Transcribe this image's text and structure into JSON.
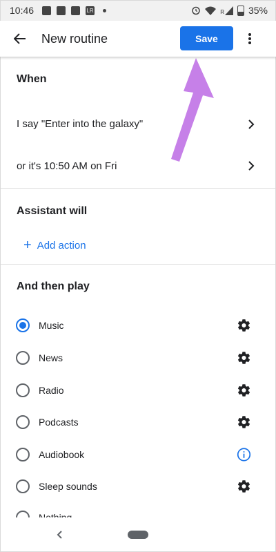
{
  "status_bar": {
    "time": "10:46",
    "battery": "35%",
    "left_icons": [
      "image-icon",
      "news-icon",
      "chat-icon",
      "lightroom-icon"
    ],
    "lightroom_text": "LR",
    "right_icons": [
      "alarm-icon",
      "wifi-icon",
      "signal-icon",
      "battery-icon"
    ],
    "signal_label": "R"
  },
  "app_bar": {
    "title": "New routine",
    "save_label": "Save",
    "accent": "#1a73e8"
  },
  "when_section": {
    "heading": "When",
    "rows": [
      {
        "label": "I say \"Enter into the galaxy\""
      },
      {
        "label": "or it's 10:50 AM on Fri"
      }
    ]
  },
  "assistant_section": {
    "heading": "Assistant will",
    "add_action_label": "Add action"
  },
  "then_play_section": {
    "heading": "And then play",
    "options": [
      {
        "label": "Music",
        "selected": true,
        "icon": "gear-icon"
      },
      {
        "label": "News",
        "selected": false,
        "icon": "gear-icon"
      },
      {
        "label": "Radio",
        "selected": false,
        "icon": "gear-icon"
      },
      {
        "label": "Podcasts",
        "selected": false,
        "icon": "gear-icon"
      },
      {
        "label": "Audiobook",
        "selected": false,
        "icon": "info-icon"
      },
      {
        "label": "Sleep sounds",
        "selected": false,
        "icon": "gear-icon"
      },
      {
        "label": "Nothing",
        "selected": false,
        "icon": ""
      }
    ]
  },
  "annotation": {
    "arrow_color": "#c680e8"
  }
}
